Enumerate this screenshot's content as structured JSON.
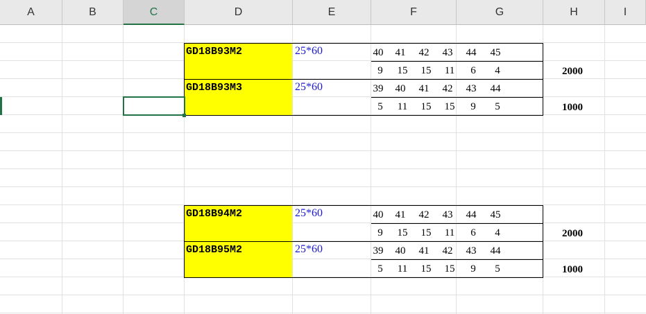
{
  "columns": [
    "A",
    "B",
    "C",
    "D",
    "E",
    "F",
    "G",
    "H",
    "I"
  ],
  "selected_column": "C",
  "blocks": [
    {
      "rows": [
        {
          "code": "GD18B93M2",
          "dim": "25*60",
          "sizes": [
            "40",
            "41",
            "42",
            "43",
            "44",
            "45"
          ],
          "qty": [
            "9",
            "15",
            "15",
            "11",
            "6",
            "4"
          ],
          "total": "2000"
        },
        {
          "code": "GD18B93M3",
          "dim": "25*60",
          "sizes": [
            "39",
            "40",
            "41",
            "42",
            "43",
            "44"
          ],
          "qty": [
            "5",
            "11",
            "15",
            "15",
            "9",
            "5"
          ],
          "total": "1000"
        }
      ]
    },
    {
      "rows": [
        {
          "code": "GD18B94M2",
          "dim": "25*60",
          "sizes": [
            "40",
            "41",
            "42",
            "43",
            "44",
            "45"
          ],
          "qty": [
            "9",
            "15",
            "15",
            "11",
            "6",
            "4"
          ],
          "total": "2000"
        },
        {
          "code": "GD18B95M2",
          "dim": "25*60",
          "sizes": [
            "39",
            "40",
            "41",
            "42",
            "43",
            "44"
          ],
          "qty": [
            "5",
            "11",
            "15",
            "15",
            "9",
            "5"
          ],
          "total": "1000"
        }
      ]
    }
  ],
  "colors": {
    "highlight": "#ffff00",
    "selection": "#217346",
    "dim_text": "#1a1acc"
  }
}
